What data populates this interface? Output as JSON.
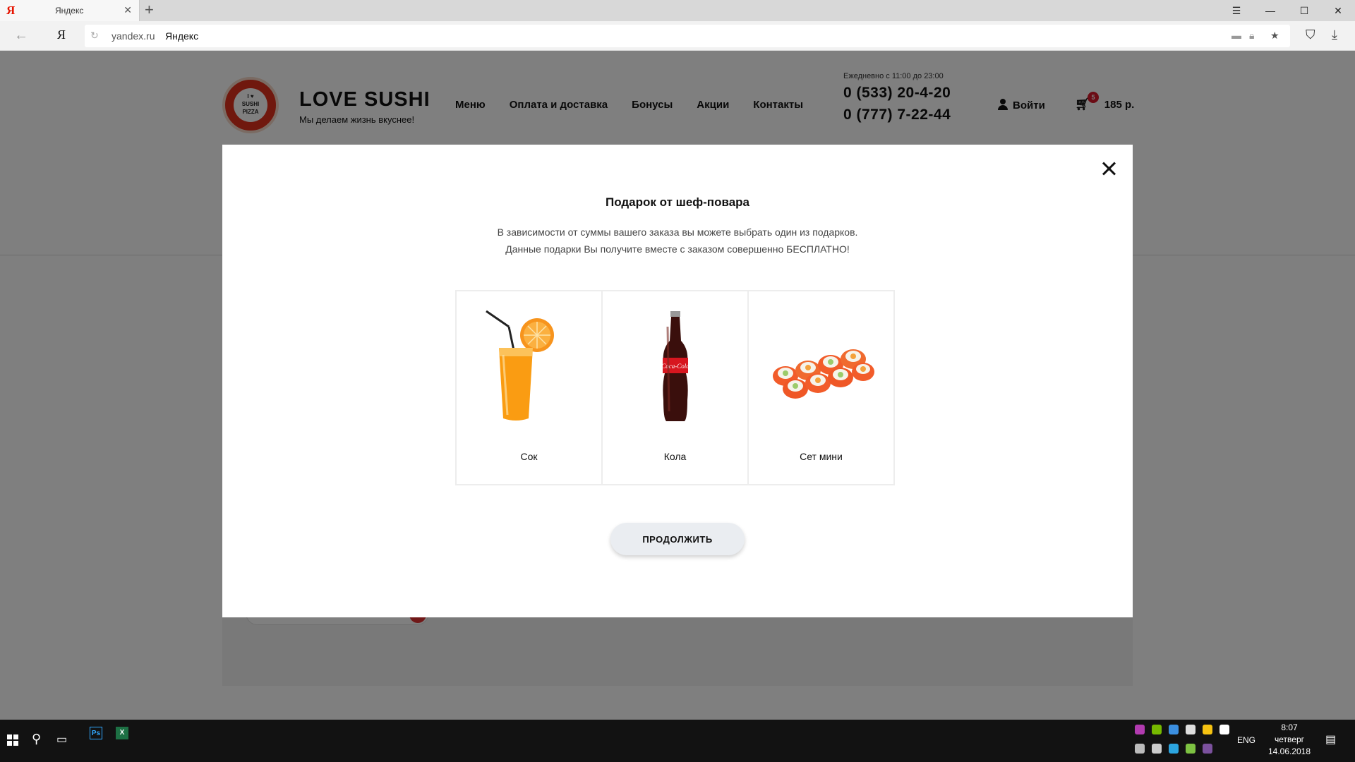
{
  "browser": {
    "tab_title": "Яндекс",
    "tab_favicon": "Я",
    "address_logo": "Я",
    "url_domain": "yandex.ru",
    "url_title": "Яндекс"
  },
  "site": {
    "brand": "LOVE SUSHI",
    "tagline": "Мы делаем жизнь вкуснее!",
    "logo_text": "SUSHI PIZZA",
    "nav": [
      "Меню",
      "Оплата и доставка",
      "Бонусы",
      "Акции",
      "Контакты"
    ],
    "hours": "Ежедневно с 11:00 до 23:00",
    "phones": [
      "0 (533) 20-4-20",
      "0 (777) 7-22-44"
    ],
    "login_label": "Войти",
    "cart_count": "5",
    "cart_total": "185 р."
  },
  "modal": {
    "title": "Подарок от шеф-повара",
    "description_line1": "В зависимости от суммы вашего заказа вы можете выбрать один из подарков.",
    "description_line2": "Данные подарки Вы получите вместе с заказом совершенно БЕСПЛАТНО!",
    "gifts": [
      {
        "name": "Сок",
        "icon": "orange-juice-image"
      },
      {
        "name": "Кола",
        "icon": "cola-bottle-image"
      },
      {
        "name": "Сет мини",
        "icon": "sushi-rolls-image"
      }
    ],
    "continue_label": "ПРОДОЛЖИТЬ"
  },
  "taskbar": {
    "apps": [
      "Ps",
      "X"
    ],
    "language": "ENG",
    "time": "8:07",
    "weekday": "четверг",
    "date": "14.06.2018"
  },
  "colors": {
    "accent_red": "#e1301c",
    "badge_red": "#d6182b",
    "button_bg": "#eaedf1",
    "overlay": "rgba(0,0,0,0.5)"
  }
}
